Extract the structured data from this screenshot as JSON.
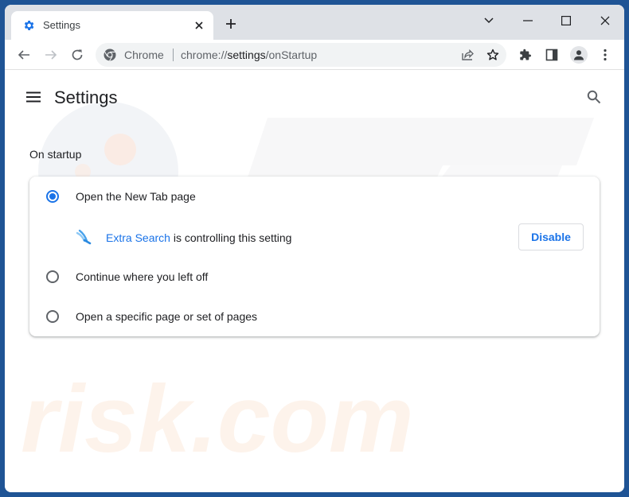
{
  "browser": {
    "tab": {
      "title": "Settings",
      "favicon": "gear-icon"
    },
    "window_controls": [
      "tab-search",
      "minimize",
      "maximize",
      "close"
    ],
    "omnibox": {
      "site_label": "Chrome",
      "url_prefix": "chrome://",
      "url_host": "settings",
      "url_path": "/onStartup"
    },
    "toolbar_icons": [
      "share-icon",
      "bookmark-star-icon",
      "extensions-icon",
      "side-panel-icon",
      "profile-icon",
      "more-menu-icon"
    ]
  },
  "page": {
    "title": "Settings",
    "section_title": "On startup",
    "options": [
      {
        "label": "Open the New Tab page",
        "checked": true
      },
      {
        "label": "Continue where you left off",
        "checked": false
      },
      {
        "label": "Open a specific page or set of pages",
        "checked": false
      }
    ],
    "controlled_by": {
      "extension_name": "Extra Search",
      "message": " is controlling this setting",
      "button_label": "Disable"
    }
  },
  "colors": {
    "accent": "#1a73e8",
    "frame": "#1f5495",
    "titlebar": "#dee1e6"
  }
}
